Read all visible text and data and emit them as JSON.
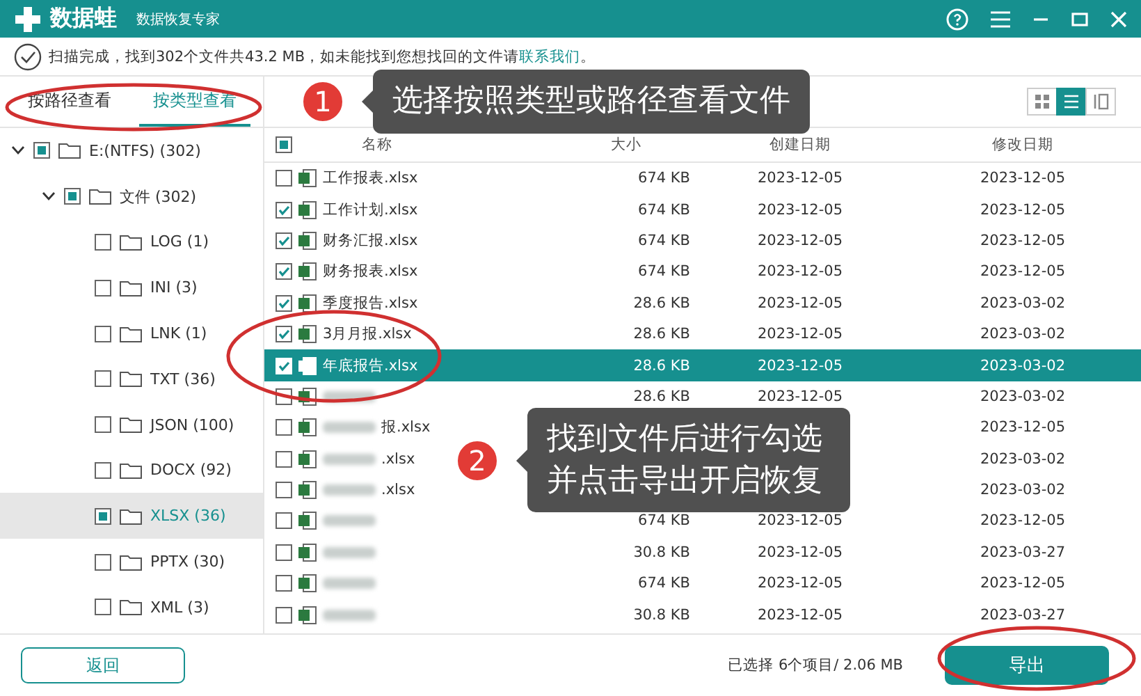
{
  "window": {
    "app_name": "数据蛙",
    "subtitle": "数据恢复专家"
  },
  "status": {
    "text": "扫描完成，找到302个文件共43.2 MB，如未能找到您想找回的文件请",
    "link": "联系我们",
    "end": "。"
  },
  "tabs": [
    {
      "label": "按路径查看",
      "selected": false
    },
    {
      "label": "按类型查看",
      "selected": true
    }
  ],
  "view_modes": [
    {
      "kind": "grid",
      "selected": false
    },
    {
      "kind": "list",
      "selected": true
    },
    {
      "kind": "split",
      "selected": false
    }
  ],
  "tree": [
    {
      "label": "E:(NTFS) (302)",
      "checked": true,
      "expanded": true,
      "selected": false,
      "children": [
        {
          "label": "文件 (302)",
          "checked": true,
          "expanded": true,
          "selected": false,
          "children": [
            {
              "label": "LOG (1)",
              "checked": false,
              "selected": false
            },
            {
              "label": "INI (3)",
              "checked": false,
              "selected": false
            },
            {
              "label": "LNK (1)",
              "checked": false,
              "selected": false
            },
            {
              "label": "TXT (36)",
              "checked": false,
              "selected": false
            },
            {
              "label": "JSON (100)",
              "checked": false,
              "selected": false
            },
            {
              "label": "DOCX (92)",
              "checked": false,
              "selected": false
            },
            {
              "label": "XLSX (36)",
              "checked": true,
              "selected": true
            },
            {
              "label": "PPTX (30)",
              "checked": false,
              "selected": false
            },
            {
              "label": "XML (3)",
              "checked": false,
              "selected": false
            }
          ]
        }
      ]
    }
  ],
  "table": {
    "select_all": true,
    "columns": [
      "名称",
      "大小",
      "创建日期",
      "修改日期"
    ],
    "rows": [
      {
        "name": "工作报表.xlsx",
        "size": "674 KB",
        "created": "2023-12-05",
        "modified": "2023-12-05",
        "checked": false,
        "selected": false,
        "blurred": false
      },
      {
        "name": "工作计划.xlsx",
        "size": "674 KB",
        "created": "2023-12-05",
        "modified": "2023-12-05",
        "checked": true,
        "selected": false,
        "blurred": false
      },
      {
        "name": "财务汇报.xlsx",
        "size": "674 KB",
        "created": "2023-12-05",
        "modified": "2023-12-05",
        "checked": true,
        "selected": false,
        "blurred": false
      },
      {
        "name": "财务报表.xlsx",
        "size": "674 KB",
        "created": "2023-12-05",
        "modified": "2023-12-05",
        "checked": true,
        "selected": false,
        "blurred": false
      },
      {
        "name": "季度报告.xlsx",
        "size": "28.6 KB",
        "created": "2023-12-05",
        "modified": "2023-03-02",
        "checked": true,
        "selected": false,
        "blurred": false
      },
      {
        "name": "3月月报.xlsx",
        "size": "28.6 KB",
        "created": "2023-12-05",
        "modified": "2023-03-02",
        "checked": true,
        "selected": false,
        "blurred": false
      },
      {
        "name": "年底报告.xlsx",
        "size": "28.6 KB",
        "created": "2023-12-05",
        "modified": "2023-03-02",
        "checked": true,
        "selected": true,
        "blurred": false
      },
      {
        "size": "28.6 KB",
        "created": "2023-12-05",
        "modified": "2023-03-02",
        "checked": false,
        "selected": false,
        "blurred": true
      },
      {
        "name": "报.xlsx",
        "modified": "2023-12-05",
        "checked": false,
        "selected": false,
        "blurred": true
      },
      {
        "name": ".xlsx",
        "modified": "2023-03-02",
        "checked": false,
        "selected": false,
        "blurred": true
      },
      {
        "name": ".xlsx",
        "modified": "2023-03-02",
        "checked": false,
        "selected": false,
        "blurred": true
      },
      {
        "size": "674 KB",
        "created": "2023-12-05",
        "modified": "2023-12-05",
        "checked": false,
        "selected": false,
        "blurred": true
      },
      {
        "size": "30.8 KB",
        "created": "2023-12-05",
        "modified": "2023-03-27",
        "checked": false,
        "selected": false,
        "blurred": true
      },
      {
        "size": "674 KB",
        "created": "2023-12-05",
        "modified": "2023-12-05",
        "checked": false,
        "selected": false,
        "blurred": true
      },
      {
        "size": "30.8 KB",
        "created": "2023-12-05",
        "modified": "2023-03-27",
        "checked": false,
        "selected": false,
        "blurred": true
      }
    ]
  },
  "footer": {
    "back": "返回",
    "summary": "已选择 6个项目/ 2.06 MB",
    "export": "导出"
  },
  "callouts": [
    {
      "number": "1",
      "text": "选择按照类型或路径查看文件"
    },
    {
      "number": "2",
      "text": "找到文件后进行勾选并点击导出开启恢复"
    }
  ]
}
